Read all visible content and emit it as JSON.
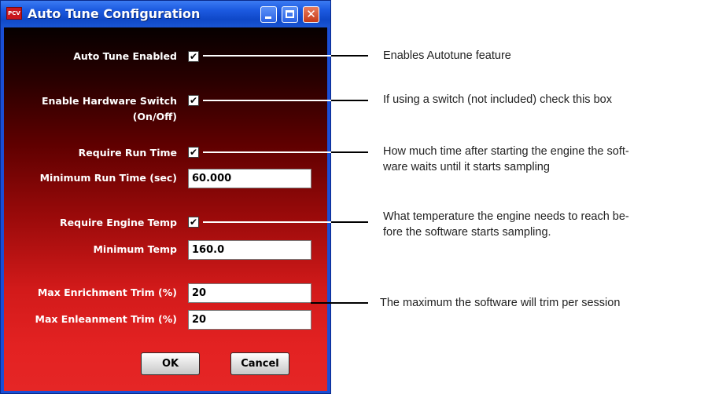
{
  "window": {
    "title": "Auto Tune Configuration",
    "icon_label": "PCV"
  },
  "form": {
    "auto_tune_enabled": {
      "label": "Auto Tune Enabled",
      "checked": true
    },
    "enable_hardware_switch": {
      "label_line1": "Enable Hardware Switch",
      "label_line2": "(On/Off)",
      "checked": true
    },
    "require_run_time": {
      "label": "Require Run Time",
      "checked": true
    },
    "minimum_run_time": {
      "label": "Minimum Run Time (sec)",
      "value": "60.000"
    },
    "require_engine_temp": {
      "label": "Require Engine Temp",
      "checked": true
    },
    "minimum_temp": {
      "label": "Minimum Temp",
      "value": "160.0"
    },
    "max_enrichment_trim": {
      "label": "Max Enrichment Trim (%)",
      "value": "20"
    },
    "max_enleanment_trim": {
      "label": "Max Enleanment Trim (%)",
      "value": "20"
    },
    "ok_label": "OK",
    "cancel_label": "Cancel",
    "check_glyph": "✔"
  },
  "annotations": {
    "autotune": "Enables Autotune feature",
    "hardware_switch": "If using a switch (not included) check this box",
    "run_time_line1": "How much time after starting the engine the soft-",
    "run_time_line2": "ware waits until it starts sampling",
    "engine_temp_line1": "What temperature the engine needs to reach be-",
    "engine_temp_line2": "fore the software starts sampling.",
    "trim": "The maximum the software will trim per session"
  },
  "colors": {
    "titlebar": "#1c5ae0",
    "client_top": "#060000",
    "client_bottom": "#e52626"
  }
}
